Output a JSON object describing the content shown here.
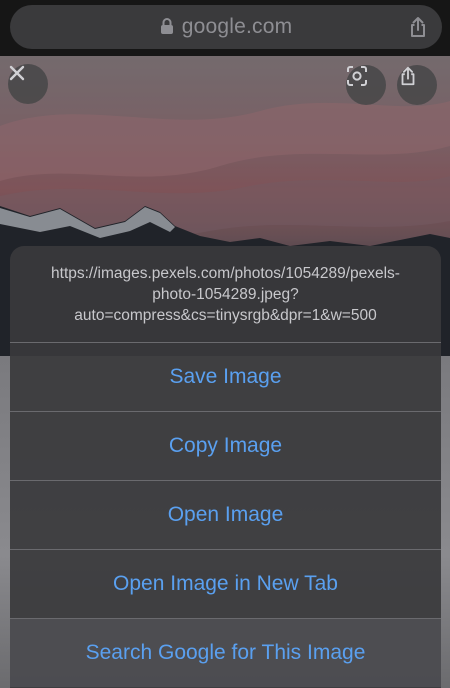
{
  "browser": {
    "url_display": "google.com"
  },
  "sheet": {
    "url_lines": [
      "https://images.pexels.com/photos/1054289/pexels-",
      "photo-1054289.jpeg?",
      "auto=compress&cs=tinysrgb&dpr=1&w=500"
    ],
    "actions": [
      "Save Image",
      "Copy Image",
      "Open Image",
      "Open Image in New Tab",
      "Search Google for This Image"
    ]
  },
  "colors": {
    "action_text": "#5aa0f0",
    "sheet_bg": "#3a3a3c",
    "top_bar": "#161616"
  },
  "icons": {
    "lock": "lock-icon",
    "share": "share-icon",
    "close": "close-icon",
    "lens": "lens-icon"
  }
}
